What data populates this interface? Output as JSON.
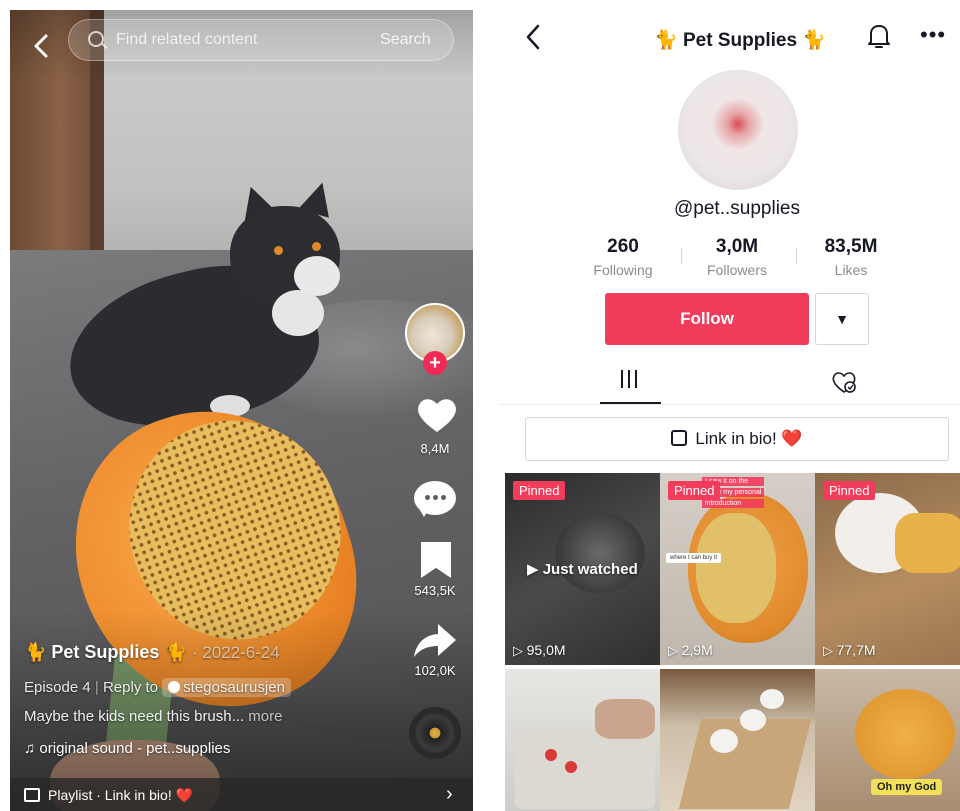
{
  "video": {
    "search_placeholder": "Find related content",
    "search_button": "Search",
    "likes": "8,4M",
    "comments": "",
    "saves": "543,5K",
    "shares": "102,0K",
    "author": "🐈 Pet Supplies 🐈",
    "date": "· 2022-6-24",
    "episode": "Episode 4",
    "reply_to": "Reply to",
    "reply_user": "stegosaurusjen",
    "description": "Maybe the kids need this brush...",
    "more": "more",
    "sound": "♫ original sound - pet..supplies",
    "playlist": "Playlist · Link in bio!",
    "heart_emoji": "❤️"
  },
  "profile": {
    "title": "🐈 Pet Supplies 🐈",
    "handle": "@pet..supplies",
    "stats": [
      {
        "value": "260",
        "label": "Following"
      },
      {
        "value": "3,0M",
        "label": "Followers"
      },
      {
        "value": "83,5M",
        "label": "Likes"
      }
    ],
    "follow_label": "Follow",
    "more_label": "▼",
    "bio_link": "Link in bio!",
    "heart_emoji": "❤️"
  },
  "grid": [
    {
      "pinned": "Pinned",
      "overlay": "Just watched",
      "views": "95,0M",
      "colors": [
        "#2b2b2c",
        "#5a5a5c"
      ]
    },
    {
      "pinned": "Pinned",
      "overlay": "",
      "views": "2,9M",
      "colors": [
        "#c9c1b8",
        "#e3a04a"
      ],
      "notes": [
        "I saw it on the",
        "show my personal",
        "introduction"
      ],
      "chat": "where I can buy it"
    },
    {
      "pinned": "Pinned",
      "overlay": "",
      "views": "77,7M",
      "colors": [
        "#b48a5e",
        "#e9e3dc"
      ]
    },
    {
      "pinned": "",
      "overlay": "",
      "views": "",
      "colors": [
        "#e4e2df",
        "#c8c6c2"
      ]
    },
    {
      "pinned": "",
      "overlay": "",
      "views": "",
      "colors": [
        "#d6c9b6",
        "#8a6a48"
      ]
    },
    {
      "pinned": "",
      "overlay": "Oh my God",
      "views": "",
      "colors": [
        "#e0a24a",
        "#8f6f4e"
      ]
    }
  ],
  "colors": {
    "accent": "#f23c5c",
    "heart": "#e1242f",
    "plus": "#ef2a55"
  },
  "icons": {
    "back": "chevron-left-icon",
    "search": "search-icon",
    "like": "heart-icon",
    "comment": "comment-icon",
    "save": "bookmark-icon",
    "share": "share-icon",
    "sound": "music-disc-icon",
    "notifications": "bell-icon",
    "more": "more-horizontal-icon",
    "grid": "grid-icon",
    "liked": "liked-hearts-icon"
  }
}
